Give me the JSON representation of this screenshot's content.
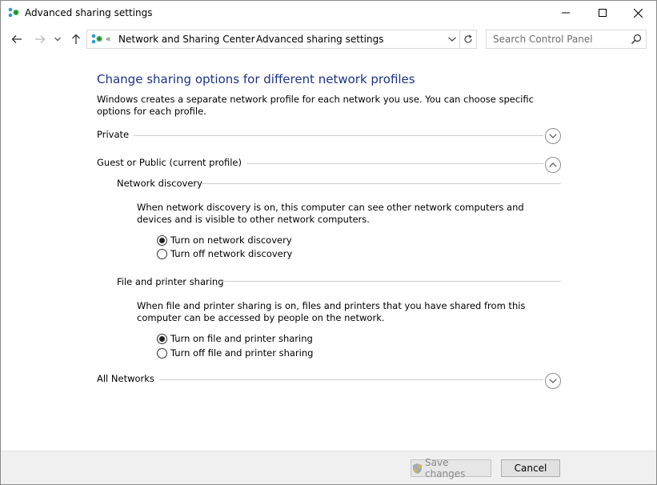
{
  "window": {
    "title": "Advanced sharing settings",
    "icon": "network-sharing-icon"
  },
  "nav": {
    "back_icon": "arrow-left-icon",
    "forward_icon": "arrow-right-icon",
    "recent_icon": "chevron-down-icon",
    "up_icon": "arrow-up-icon"
  },
  "address": {
    "overflow": "«",
    "crumbs": [
      "Network and Sharing Center",
      "Advanced sharing settings"
    ],
    "separator": "›"
  },
  "search": {
    "placeholder": "Search Control Panel"
  },
  "main": {
    "heading": "Change sharing options for different network profiles",
    "description": "Windows creates a separate network profile for each network you use. You can choose specific options for each profile.",
    "profiles": [
      {
        "label": "Private",
        "expanded": false
      },
      {
        "label": "Guest or Public (current profile)",
        "expanded": true
      },
      {
        "label": "All Networks",
        "expanded": false
      }
    ],
    "network_discovery": {
      "title": "Network discovery",
      "text": "When network discovery is on, this computer can see other network computers and devices and is visible to other network computers.",
      "options": [
        {
          "label": "Turn on network discovery",
          "checked": true
        },
        {
          "label": "Turn off network discovery",
          "checked": false
        }
      ]
    },
    "file_sharing": {
      "title": "File and printer sharing",
      "text": "When file and printer sharing is on, files and printers that you have shared from this computer can be accessed by people on the network.",
      "options": [
        {
          "label": "Turn on file and printer sharing",
          "checked": true
        },
        {
          "label": "Turn off file and printer sharing",
          "checked": false
        }
      ]
    }
  },
  "footer": {
    "save_label": "Save changes",
    "cancel_label": "Cancel"
  },
  "colors": {
    "heading": "#1e3287",
    "footer_bg": "#f0f0f0"
  }
}
